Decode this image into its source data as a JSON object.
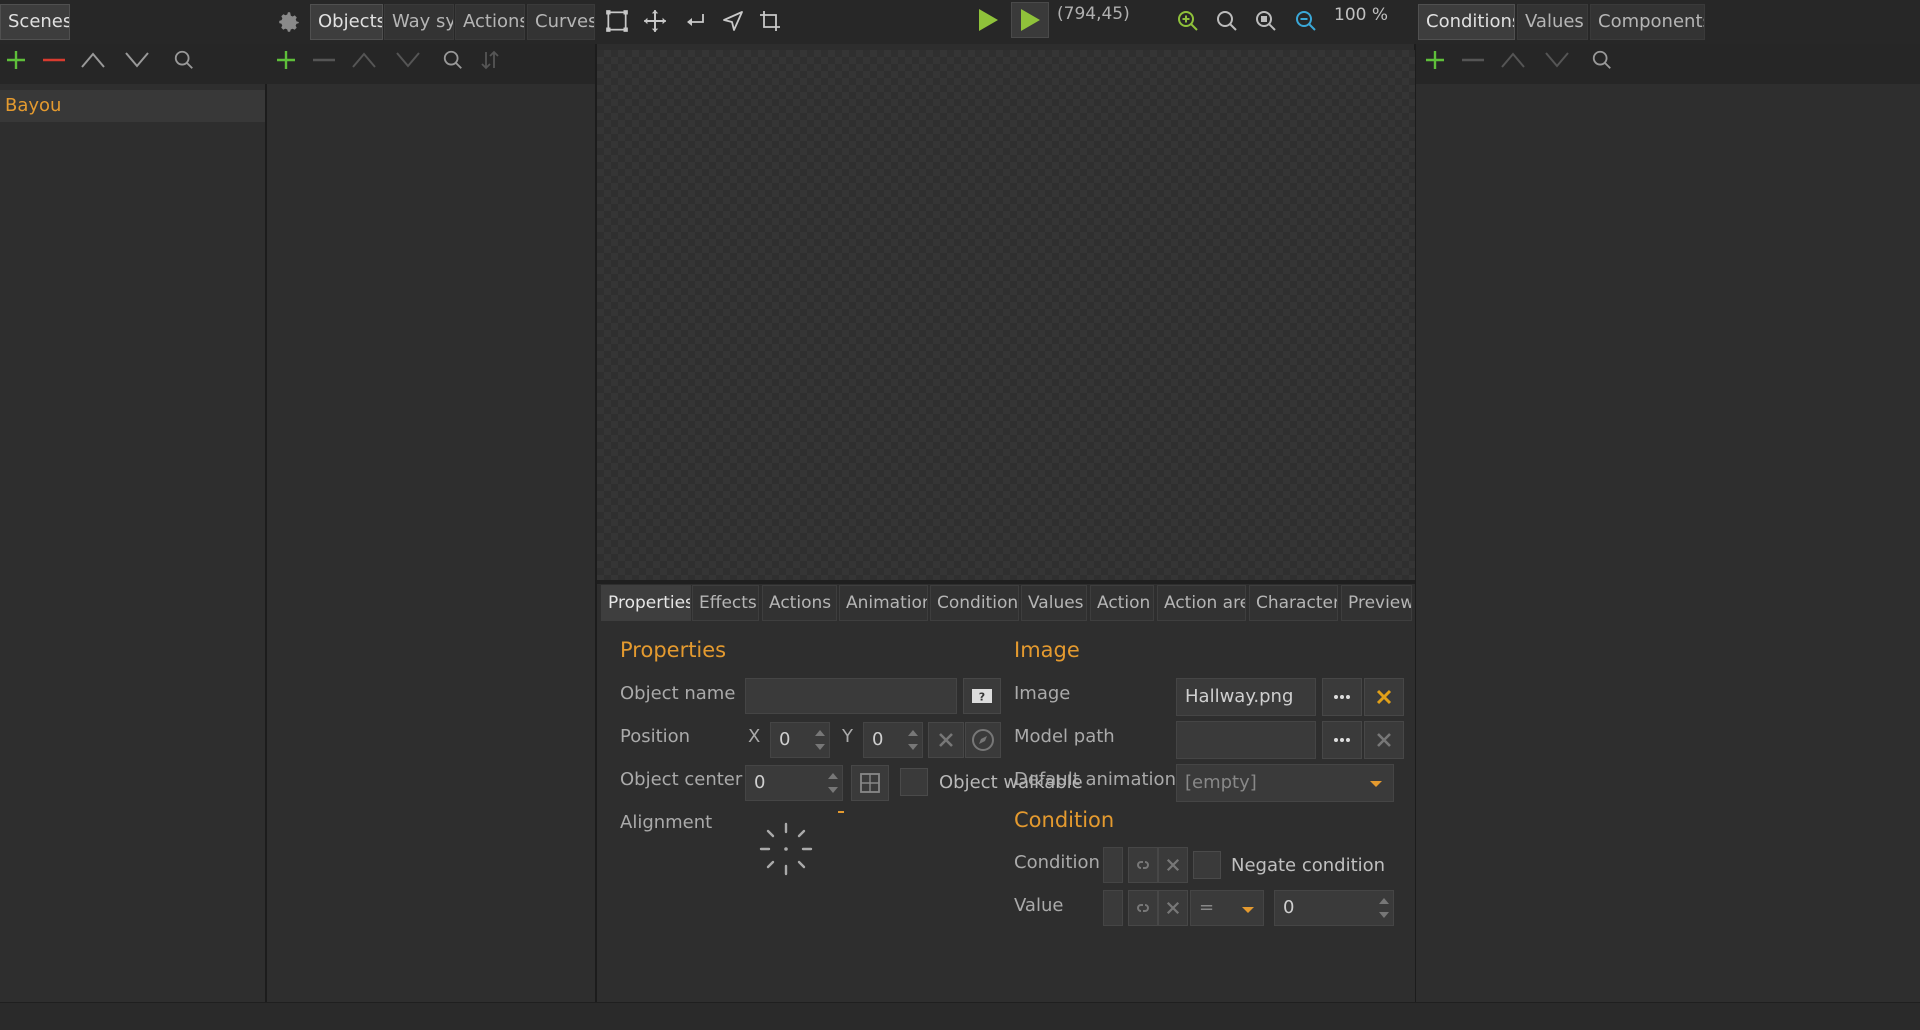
{
  "top_tabs": {
    "scenes": "Scenes",
    "objects": "Objects",
    "way_systems": "Way sys",
    "actions": "Actions",
    "curves": "Curves",
    "conditions": "Conditions",
    "values": "Values",
    "components": "Components"
  },
  "coords": "(794,45)",
  "zoom": "100 %",
  "scenes": [
    {
      "label": "Bayou"
    }
  ],
  "bottom_tabs": [
    "Properties",
    "Effects",
    "Actions",
    "Animations",
    "Conditions",
    "Values",
    "Action",
    "Action area",
    "Character",
    "Preview"
  ],
  "properties": {
    "title": "Properties",
    "object_name_label": "Object name",
    "object_name_value": "",
    "position_label": "Position",
    "x_label": "X",
    "x_value": "0",
    "y_label": "Y",
    "y_value": "0",
    "object_center_label": "Object center",
    "object_center_value": "0",
    "walkable_label": "Object walkable",
    "alignment_label": "Alignment"
  },
  "image": {
    "title": "Image",
    "image_label": "Image",
    "image_value": "Hallway.png",
    "model_path_label": "Model path",
    "model_path_value": "",
    "default_animation_label": "Default animation",
    "default_animation_value": "[empty]"
  },
  "condition": {
    "title": "Condition",
    "condition_label": "Condition",
    "negate_label": "Negate condition",
    "value_label": "Value",
    "operator": "=",
    "value": "0"
  },
  "colors": {
    "accent": "#e49a2f",
    "add_green": "#5fbf3a",
    "remove_red": "#d83b2f",
    "zoom_green": "#8fc23a",
    "zoom_blue": "#3aa8d8"
  }
}
